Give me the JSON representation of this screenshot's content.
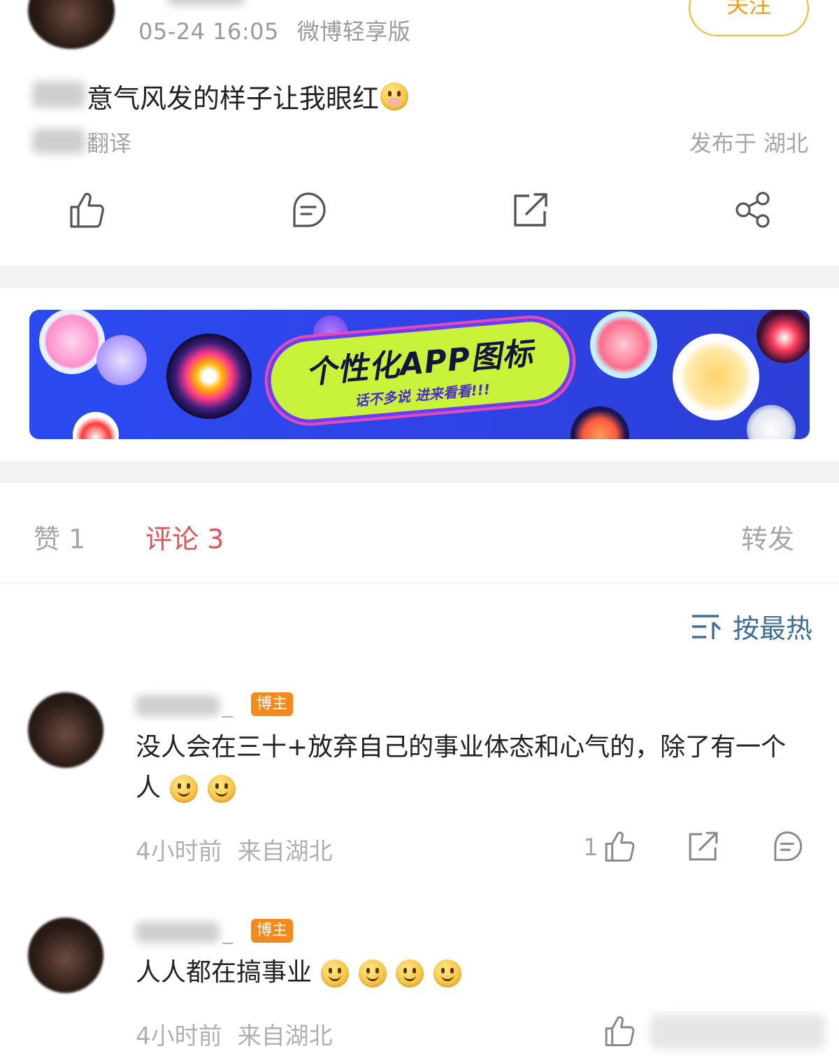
{
  "post": {
    "timestamp": "05-24 16:05",
    "source": "微博轻享版",
    "follow_label": "关注",
    "text": "意气风发的样子让我眼红",
    "translate_label": "翻译",
    "location": "发布于 湖北"
  },
  "actions": [
    "like-icon",
    "comment-icon",
    "repost-icon",
    "share-icon"
  ],
  "banner": {
    "title": "个性化APP图标",
    "subtitle": "话不多说 进来看看!!!"
  },
  "tabs": {
    "likes": "赞 1",
    "comments": "评论 3",
    "reposts": "转发"
  },
  "sort_label": "按最热",
  "comments": [
    {
      "name_suffix": "_",
      "badge": "博主",
      "text": "没人会在三十+放弃自己的事业体态和心气的，除了有一个人",
      "time": "4小时前",
      "from": "来自湖北",
      "likes": "1"
    },
    {
      "name_suffix": "_",
      "badge": "博主",
      "text": "人人都在搞事业",
      "time": "4小时前",
      "from": "来自湖北",
      "likes": ""
    }
  ],
  "colors": {
    "accent_red": "#e0545b",
    "follow_orange": "#f0a020",
    "badge_orange": "#f28a1e",
    "sort_blue": "#3e6f97",
    "muted": "#a6a6a6"
  }
}
